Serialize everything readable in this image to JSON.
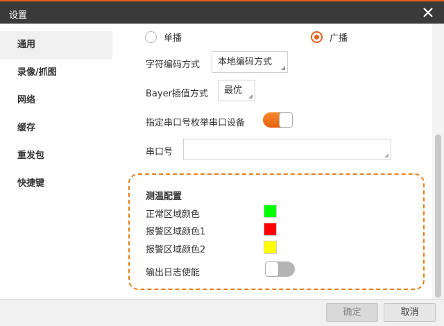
{
  "window": {
    "title": "设置",
    "close_icon": "close-icon"
  },
  "sidebar": {
    "items": [
      {
        "label": "通用",
        "active": true
      },
      {
        "label": "录像/抓图",
        "active": false
      },
      {
        "label": "网络",
        "active": false
      },
      {
        "label": "缓存",
        "active": false
      },
      {
        "label": "重发包",
        "active": false
      },
      {
        "label": "快捷键",
        "active": false
      }
    ]
  },
  "main": {
    "cast_mode": {
      "options": [
        "单播",
        "广播"
      ],
      "selected": "广播"
    },
    "char_encoding": {
      "label": "字符编码方式",
      "value": "本地编码方式"
    },
    "bayer": {
      "label": "Bayer插值方式",
      "value": "最优"
    },
    "serial_enum": {
      "label": "指定串口号枚举串口设备",
      "enabled": true
    },
    "serial_port": {
      "label": "串口号",
      "value": ""
    },
    "temperature": {
      "heading": "测温配置",
      "normal_color_label": "正常区域颜色",
      "normal_color": "#00ff00",
      "alarm1_label": "报警区域颜色1",
      "alarm1_color": "#ff0000",
      "alarm2_label": "报警区域颜色2",
      "alarm2_color": "#ffff00",
      "log_label": "输出日志使能",
      "log_enabled": false
    }
  },
  "footer": {
    "ok_label": "确定",
    "cancel_label": "取消"
  },
  "colors": {
    "accent": "#e8601c",
    "titlebar": "#3a3a3a"
  }
}
